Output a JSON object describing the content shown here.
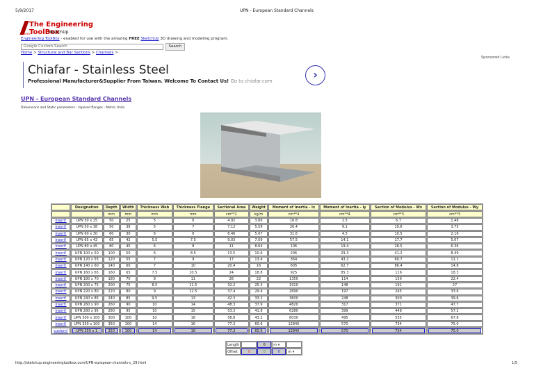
{
  "print_header": {
    "date": "5/9/2017",
    "title": "UPN - European Standard Channels"
  },
  "logo": {
    "title": "The Engineering ToolBox",
    "sub": "SketchUp",
    "home": "Home"
  },
  "intro": {
    "link": "Engineering ToolBox",
    "text1": " - enabled for use with the amazing ",
    "free": "FREE",
    "sketchup": "SketchUp",
    "text2": " 3D drawing and modeling program."
  },
  "search": {
    "placeholder": "Google Custom Search",
    "button": "Search"
  },
  "breadcrumb": [
    "Home",
    "Structural and Bar Sections",
    "Channels"
  ],
  "sponsored": "Sponsored Links",
  "ad": {
    "title": "Chiafar - Stainless Steel",
    "text": "Professional Manufacturer&Supplier From Taiwan. Welcome To Contact Us! ",
    "link": "Go to chiafar.com"
  },
  "page": {
    "title": "UPN - European Standard Channels",
    "desc": "Dimensions and Static parameters - tapered flanges - Metric Units"
  },
  "table": {
    "headers": [
      "Designation",
      "Depth",
      "Width",
      "Thickness Web",
      "Thickness Flange",
      "Sectional Area",
      "Weight",
      "Moment of Inertia - Ix",
      "Moment of Inertia - Iy",
      "Section of Modulus - Wx",
      "Section of Modulus - Wy"
    ],
    "units": [
      "",
      "mm",
      "mm",
      "mm",
      "mm",
      "cm**2",
      "kg/m",
      "cm**4",
      "cm**4",
      "cm**3",
      "cm**3"
    ],
    "insert_label": "insert!",
    "rows": [
      [
        "UPN 50 x 25",
        "50",
        "25",
        "5",
        "6",
        "4.92",
        "3.86",
        "16.8",
        "2.5",
        "6.7",
        "1.48"
      ],
      [
        "UPN 50 x 38",
        "50",
        "38",
        "5",
        "7",
        "7.12",
        "5.59",
        "26.4",
        "9.1",
        "10.6",
        "3.75"
      ],
      [
        "UPN 60 x 30",
        "60",
        "30",
        "6",
        "6",
        "6.46",
        "5.07",
        "31.6",
        "4.5",
        "10.5",
        "2.16"
      ],
      [
        "UPN 65 x 42",
        "65",
        "42",
        "5.5",
        "7.5",
        "9.03",
        "7.09",
        "57.5",
        "14.1",
        "17.7",
        "5.07"
      ],
      [
        "UPN 80 x 45",
        "80",
        "45",
        "6",
        "8",
        "11",
        "8.64",
        "106",
        "19.4",
        "26.5",
        "6.36"
      ],
      [
        "UPN 100 x 50",
        "100",
        "50",
        "6",
        "8.5",
        "13.5",
        "10.6",
        "206",
        "29.3",
        "41.2",
        "8.49"
      ],
      [
        "UPN 120 x 55",
        "120",
        "55",
        "7",
        "9",
        "17",
        "13.4",
        "364",
        "43.2",
        "60.7",
        "11.1"
      ],
      [
        "UPN 140 x 60",
        "140",
        "60",
        "7",
        "10",
        "20.4",
        "16",
        "605",
        "62.7",
        "86.4",
        "14.8"
      ],
      [
        "UPN 160 x 65",
        "160",
        "65",
        "7.5",
        "10.5",
        "24",
        "18.8",
        "925",
        "85.3",
        "116",
        "18.3"
      ],
      [
        "UPN 180 x 70",
        "180",
        "70",
        "8",
        "11",
        "28",
        "22",
        "1350",
        "114",
        "150",
        "22.4"
      ],
      [
        "UPN 200 x 75",
        "200",
        "75",
        "8.5",
        "11.5",
        "32.2",
        "25.3",
        "1910",
        "148",
        "191",
        "27"
      ],
      [
        "UPN 220 x 80",
        "220",
        "80",
        "9",
        "12.5",
        "37.4",
        "29.4",
        "2690",
        "197",
        "245",
        "33.6"
      ],
      [
        "UPN 240 x 85",
        "240",
        "85",
        "9.5",
        "13",
        "42.3",
        "33.2",
        "3600",
        "248",
        "300",
        "39.6"
      ],
      [
        "UPN 260 x 90",
        "260",
        "90",
        "10",
        "14",
        "48.3",
        "37.9",
        "4820",
        "317",
        "371",
        "47.7"
      ],
      [
        "UPN 280 x 95",
        "280",
        "95",
        "10",
        "15",
        "53.3",
        "41.8",
        "6280",
        "399",
        "448",
        "57.2"
      ],
      [
        "UPN 300 x 100",
        "300",
        "100",
        "10",
        "16",
        "58.8",
        "43.2",
        "8030",
        "495",
        "535",
        "67.8"
      ],
      [
        "UPN 350 x 100",
        "350",
        "100",
        "14",
        "16",
        "77.3",
        "60.6",
        "12840",
        "570",
        "734",
        "75.0"
      ]
    ],
    "custom_label": "custom!",
    "custom_row": [
      "UPN 350 x 1",
      "350",
      "100",
      "14",
      "16",
      "77.3",
      "60.6",
      "12840",
      "570",
      "734",
      "75.0"
    ]
  },
  "calc": {
    "length_label": "Length",
    "length": "6",
    "length_unit": "m",
    "offset_label": "Offset",
    "offsets": [
      "0",
      "0",
      "0"
    ],
    "offset_unit": "m"
  },
  "print_footer": {
    "url": "http://sketchup.engineeringtoolbox.com/UPN-european-channels-c_29.html",
    "page": "1/5"
  }
}
